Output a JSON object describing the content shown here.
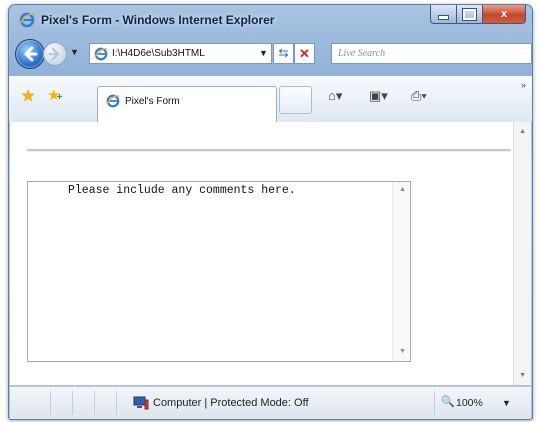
{
  "window": {
    "title": "Pixel's Form - Windows Internet Explorer",
    "title_icon": "ie-logo-icon",
    "controls": {
      "minimize": "minimize-icon",
      "maximize": "maximize-icon",
      "close_label": "x"
    }
  },
  "nav": {
    "address": "I:\\H4D6e\\Sub3HTML",
    "address_dropdown": "▼",
    "search_placeholder": "Live Search",
    "refresh_glyph": "⇆",
    "stop_glyph": "✕",
    "nav_dropdown": "▼"
  },
  "tabs": {
    "active_label": "Pixel's Form",
    "toolbar_more": "»",
    "tool_dropdown": "▾"
  },
  "page": {
    "textarea_value": "Please include any comments here."
  },
  "status": {
    "text": "Computer | Protected Mode: Off",
    "zoom": "100%",
    "zoom_dropdown": "▼"
  },
  "colors": {
    "frame": "#a9c4e2",
    "close_button": "#c7462c",
    "search_placeholder": "#8896a8"
  }
}
